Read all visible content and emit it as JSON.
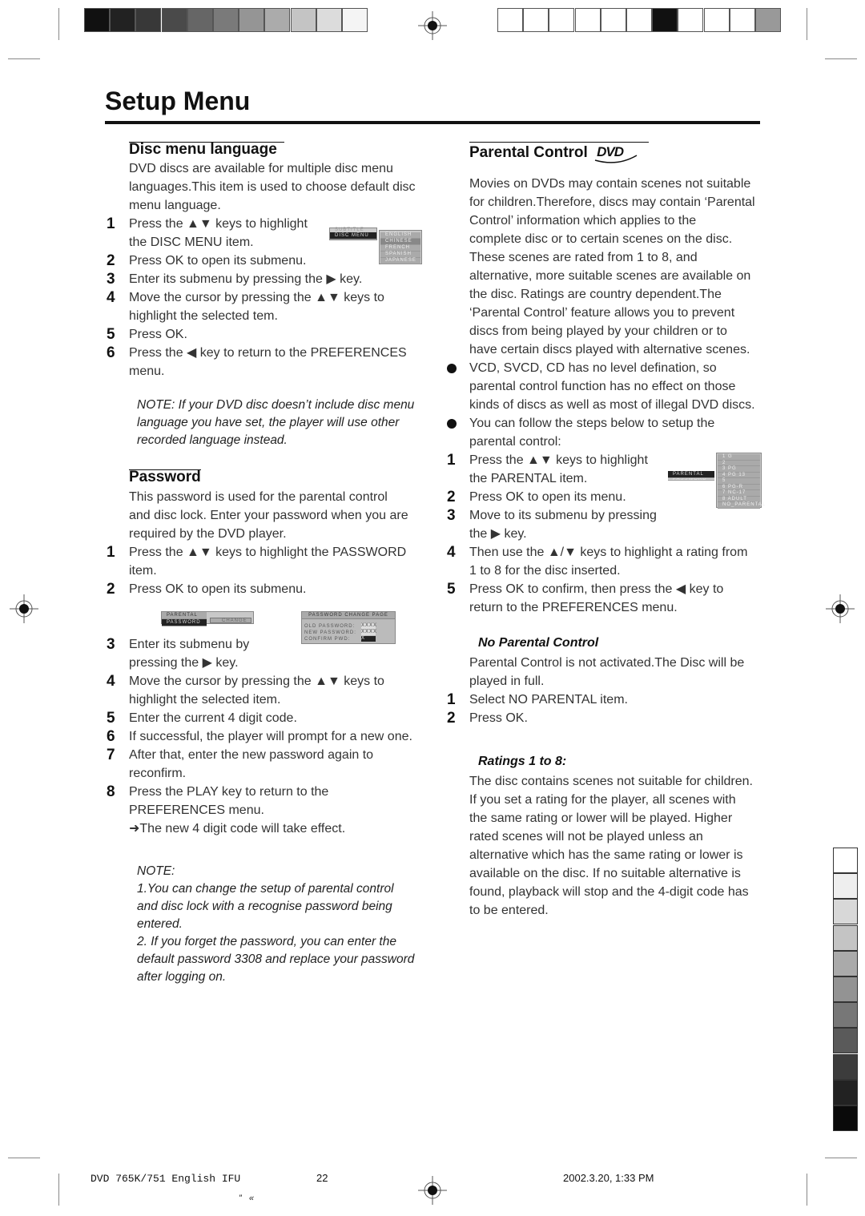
{
  "title": "Setup Menu",
  "left": {
    "disc_menu": {
      "heading": "Disc menu language",
      "rows": [
        {
          "s": "DVD discs are available for multiple disc menu"
        },
        {
          "s": "languages.This item is used to choose default disc"
        },
        {
          "s": "menu language."
        },
        {
          "n": "1",
          "s": "Press the ▲▼ keys to highlight"
        },
        {
          "s": "the DISC MENU item."
        },
        {
          "n": "2",
          "s": "Press OK to open its submenu."
        },
        {
          "n": "3",
          "s": "Enter its submenu by pressing the ▶  key."
        },
        {
          "n": "4",
          "s": "Move the cursor by pressing the ▲▼ keys to"
        },
        {
          "s": "highlight the selected tem."
        },
        {
          "n": "5",
          "s": "Press OK."
        },
        {
          "n": "6",
          "s": "Press the ◀ key to return to the PREFERENCES"
        },
        {
          "s": "menu."
        }
      ],
      "note": [
        {
          "s": "NOTE: If your DVD disc doesn’t include  disc menu"
        },
        {
          "s": "language you have set, the player will use other"
        },
        {
          "s": "recorded language instead."
        }
      ],
      "thumb": {
        "main_items": [
          "SUBTITLE",
          "DISC MENU"
        ],
        "sub_items": [
          "ENGLISH",
          "CHINESE",
          "FRENCH",
          "SPANISH",
          "JAPANESE"
        ]
      }
    },
    "password": {
      "heading": "Password",
      "rows_a": [
        {
          "s": "This password is used for the parental control"
        },
        {
          "s": "and disc lock. Enter your password when you are"
        },
        {
          "s": "required by the DVD player."
        },
        {
          "n": "1",
          "s": "Press the ▲▼ keys to highlight the PASSWORD"
        },
        {
          "s": "item."
        },
        {
          "n": "2",
          "s": "Press OK to open its submenu."
        }
      ],
      "rows_b": [
        {
          "n": "3",
          "s": "Enter its submenu by"
        },
        {
          "s": "pressing the ▶  key."
        },
        {
          "n": "4",
          "s": "Move the cursor by pressing the ▲▼ keys to"
        },
        {
          "s": "highlight the selected item."
        },
        {
          "n": "5",
          "s": "Enter the current 4 digit code."
        },
        {
          "n": "6",
          "s": "If successful, the player will prompt for a new one."
        },
        {
          "n": "7",
          "s": "After that, enter the new password again to"
        },
        {
          "s": "reconfirm."
        },
        {
          "n": "8",
          "s": "Press the PLAY key to return to the"
        },
        {
          "s": "PREFERENCES menu."
        },
        {
          "s": "➜The new 4 digit code will take effect."
        }
      ],
      "note": [
        {
          "s": "NOTE:"
        },
        {
          "s": "1.You can change the setup of parental control"
        },
        {
          "s": "and disc lock with a recognise password being"
        },
        {
          "s": "entered."
        },
        {
          "s": "2. If you forget the password, you can enter the"
        },
        {
          "s": "default password 3308 and replace your password"
        },
        {
          "s": "after logging on."
        }
      ],
      "thumb1": {
        "items": [
          "PARENTAL",
          "PASSWORD"
        ],
        "sub": "CHANGE"
      },
      "thumb2": {
        "title": "PASSWORD CHANGE PAGE",
        "labels": [
          "OLD PASSWORD:",
          "NEW PASSWORD:",
          "CONFIRM PWD:"
        ],
        "values": [
          "XXXX",
          "XXXX",
          "X"
        ]
      }
    }
  },
  "right": {
    "parental": {
      "heading": "Parental Control",
      "logo_text": "DVD",
      "rows": [
        {
          "s": "Movies on DVDs may contain scenes not suitable"
        },
        {
          "s": "for children.Therefore, discs may contain ‘Parental"
        },
        {
          "s": "Control’ information which applies to the"
        },
        {
          "s": "complete disc or to certain scenes on the disc."
        },
        {
          "s": "These scenes are rated from 1 to 8, and"
        },
        {
          "s": "alternative, more suitable scenes are available on"
        },
        {
          "s": "the disc. Ratings are country dependent.The"
        },
        {
          "s": "‘Parental Control’ feature allows you to prevent"
        },
        {
          "s": "discs from being played by your children or to"
        },
        {
          "s": "have certain discs played with alternative scenes."
        },
        {
          "b": true,
          "s": "VCD, SVCD, CD has no level defination, so"
        },
        {
          "s": "parental control function has no effect on those"
        },
        {
          "s": "kinds of discs as well as most of  illegal DVD discs."
        },
        {
          "b": true,
          "s": "You can follow the steps below to setup the"
        },
        {
          "s": "parental control:"
        },
        {
          "n": "1",
          "s": "Press the ▲▼ keys to highlight"
        },
        {
          "s": "the PARENTAL item."
        },
        {
          "n": "2",
          "s": "Press OK to open its menu."
        },
        {
          "n": "3",
          "s": "Move to its submenu by pressing"
        },
        {
          "s": "the ▶ key."
        },
        {
          "n": "4",
          "s": "Then use the ▲/▼ keys to highlight a rating from"
        },
        {
          "s": "1 to 8 for the disc inserted."
        },
        {
          "n": "5",
          "s": "Press OK to confirm, then press the ◀ key to"
        },
        {
          "s": "return to the PREFERENCES menu."
        }
      ],
      "thumb": {
        "main_items": [
          "PARENTAL",
          "PASSWORD"
        ],
        "ratings": [
          "1  G",
          "2",
          "3  PG",
          "4  PG 13",
          "5",
          "6  PG-R",
          "7  NC-17",
          "8  ADULT",
          "NO_PARENTAL"
        ]
      }
    },
    "no_parental": {
      "heading": "No Parental Control",
      "rows": [
        {
          "s": "Parental Control is not activated.The Disc will be"
        },
        {
          "s": "played in full."
        },
        {
          "n": "1",
          "s": "Select NO PARENTAL item."
        },
        {
          "n": "2",
          "s": "Press OK."
        }
      ]
    },
    "ratings": {
      "heading": "Ratings 1 to 8:",
      "rows": [
        {
          "s": "The disc contains scenes not suitable for children."
        },
        {
          "s": "If you set a rating for the player, all scenes with"
        },
        {
          "s": "the same rating or lower will be played. Higher"
        },
        {
          "s": "rated scenes will not be played unless an"
        },
        {
          "s": "alternative which has the same rating or lower is"
        },
        {
          "s": "available on the disc. If no suitable alternative is"
        },
        {
          "s": "found, playback will stop and the 4-digit code has"
        },
        {
          "s": "to be entered."
        }
      ]
    }
  },
  "footer": {
    "doc": "DVD 765K/751 English IFU",
    "page": "22",
    "date": "2002.3.20, 1:33 PM",
    "marks": "”   «"
  },
  "registration": {
    "left_bar_colors": [
      "#111111",
      "#222222",
      "#383838",
      "#4a4a4a",
      "#666666",
      "#7a7a7a",
      "#959595",
      "#ababab",
      "#c4c4c4",
      "#dcdcdc",
      "#f4f4f4"
    ],
    "right_bar_colors": [
      "#ffffff",
      "#ffffff",
      "#ffffff",
      "#ffffff",
      "#ffffff",
      "#ffffff",
      "#111111",
      "#ffffff",
      "#ffffff",
      "#ffffff",
      "#999999"
    ],
    "side_tab_colors": [
      "#ffffff",
      "#eeeeee",
      "#d8d8d8",
      "#c4c4c4",
      "#aaaaaa",
      "#939393",
      "#777777",
      "#5a5a5a",
      "#3c3c3c",
      "#222222",
      "#0a0a0a"
    ]
  }
}
